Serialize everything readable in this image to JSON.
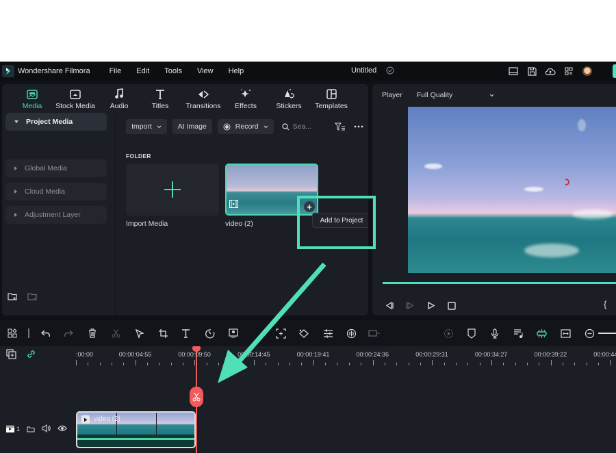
{
  "titlebar": {
    "app_name": "Wondershare Filmora",
    "menu": [
      "File",
      "Edit",
      "Tools",
      "View",
      "Help"
    ],
    "project_title": "Untitled",
    "right_icons": [
      "layout-icon",
      "save-icon",
      "cloud-upload-icon",
      "apps-grid-icon",
      "user-avatar"
    ]
  },
  "library": {
    "tabs": [
      {
        "label": "Media",
        "icon": "media-icon",
        "active": true
      },
      {
        "label": "Stock Media",
        "icon": "stock-media-icon",
        "active": false
      },
      {
        "label": "Audio",
        "icon": "music-note-icon",
        "active": false
      },
      {
        "label": "Titles",
        "icon": "text-t-icon",
        "active": false
      },
      {
        "label": "Transitions",
        "icon": "transitions-icon",
        "active": false
      },
      {
        "label": "Effects",
        "icon": "sparkle-icon",
        "active": false
      },
      {
        "label": "Stickers",
        "icon": "stickers-icon",
        "active": false
      },
      {
        "label": "Templates",
        "icon": "templates-icon",
        "active": false
      }
    ],
    "sidebar": {
      "items": [
        {
          "label": "Project Media",
          "expanded": true
        },
        {
          "label": "Global Media",
          "expanded": false
        },
        {
          "label": "Cloud Media",
          "expanded": false
        },
        {
          "label": "Adjustment Layer",
          "expanded": false
        }
      ],
      "subfolder": "Folder"
    },
    "toolbar": {
      "import_label": "Import",
      "ai_image_label": "AI Image",
      "record_label": "Record",
      "search_placeholder": "Sea..."
    },
    "section_label": "FOLDER",
    "cards": [
      {
        "label": "Import Media",
        "type": "import"
      },
      {
        "label": "video (2)",
        "type": "video",
        "selected": true
      }
    ],
    "tooltip": "Add to Project"
  },
  "player": {
    "label": "Player",
    "quality": "Full Quality",
    "progress_fraction": 1.0
  },
  "timeline": {
    "ruler_labels": [
      ":00:00",
      "00:00:04:55",
      "00:00:09:50",
      "00:00:14:45",
      "00:00:19:41",
      "00:00:24:36",
      "00:00:29:31",
      "00:00:34:27",
      "00:00:39:22",
      "00:00:44"
    ],
    "clip": {
      "name": "video (2)"
    },
    "track": {
      "number": "1"
    },
    "accent_color": "#4fd6b4",
    "playhead_color": "#f05c5c"
  },
  "annotation": {
    "highlight_color": "#4fe0b9"
  }
}
